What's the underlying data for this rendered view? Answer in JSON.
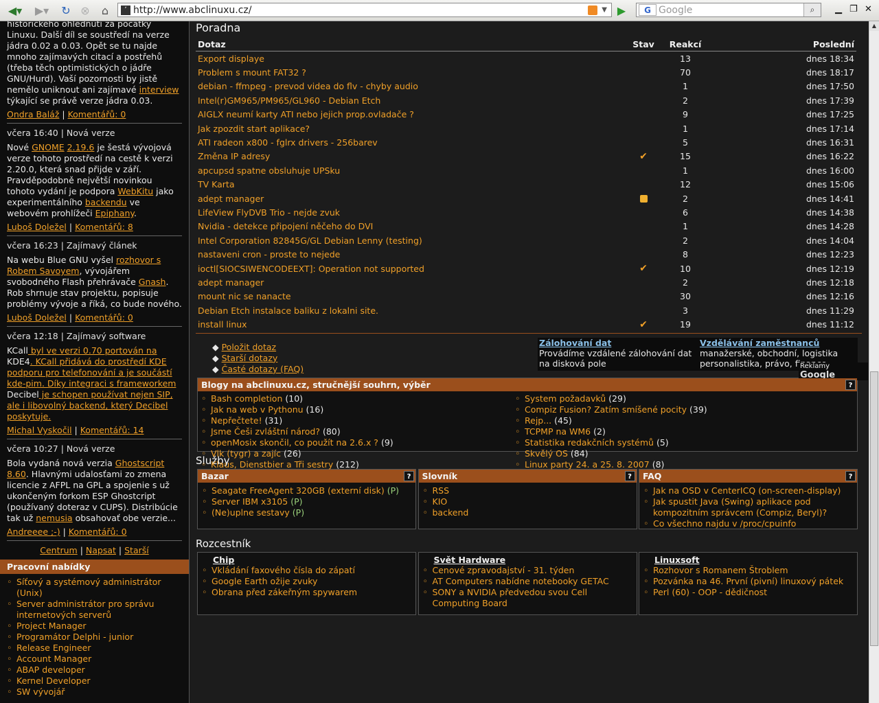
{
  "browser": {
    "url": "http://www.abclinuxu.cz/",
    "search_placeholder": "Google",
    "search_engine_badge": "G"
  },
  "left": {
    "intro_lines": [
      "historického ohlédnutí za počátky",
      "Linuxu. Další díl se soustředí na verze",
      "jádra 0.02 a 0.03. Opět se tu najde",
      "mnoho zajímavých citací a postřehů",
      "(třeba těch optimistických o jádře",
      "GNU/Hurd). Vaší pozornosti by jistě",
      "nemělo uniknout ani zajímavé"
    ],
    "intro_link": "interview",
    "intro_tail": "týkající se právě verze jádra 0.03.",
    "n0_author": "Ondra Baláž",
    "n0_comments": "Komentářů: 0",
    "n1_meta": "včera 16:40 | Nová verze",
    "n1": [
      "Nové ",
      "GNOME",
      " ",
      "2.19.6",
      " je šestá vývojová verze tohoto prostředí na cestě k verzi 2.20.0, která snad přijde v září. Pravděpodobně největší novinkou tohoto vydání je podpora ",
      "WebKitu",
      " jako experimentálního ",
      "backendu",
      " ve webovém prohlížeči ",
      "Epiphany",
      "."
    ],
    "n1_author": "Luboš Doležel",
    "n1_comments": "Komentářů: 8",
    "n2_meta": "včera 16:23 | Zajímavý článek",
    "n2": [
      "Na webu Blue GNU vyšel ",
      "rozhovor s Robem Savoyem",
      ", vývojářem svobodného Flash přehrávače ",
      "Gnash",
      ". Rob shrnuje stav projektu, popisuje problémy vývoje a říká, co bude nového."
    ],
    "n2_author": "Luboš Doležel",
    "n2_comments": "Komentářů: 0",
    "n3_meta": "včera 12:18 | Zajímavý software",
    "n3": [
      "KCall",
      " byl ve verzi 0.70 portován na ",
      "KDE4",
      ". KCall přidává do prostředí KDE podporu pro telefonování a je součástí kde-pim. Díky integraci s frameworkem ",
      "Decibel",
      " je schopen používat nejen SIP, ale i libovolný backend, který Decibel poskytuje."
    ],
    "n3_author": "Michal Vyskočil",
    "n3_comments": "Komentářů: 14",
    "n4_meta": "včera 10:27 | Nová verze",
    "n4": [
      "Bola vydaná nová verzia ",
      "Ghostscript 8.60",
      ". Hlavnými udalosťami zo zmena licencie z AFPL na GPL a spojenie s už ukončeným forkom ESP Ghostcript (používaný doteraz v CUPS). Distribúcie tak už ",
      "nemusia",
      " obsahovať obe verzie..."
    ],
    "n4_author": "Andreeee ;-)",
    "n4_comments": "Komentářů: 0",
    "nav": {
      "a": "Centrum",
      "b": "Napsat",
      "c": "Starší"
    },
    "jobs_title": "Pracovní nabídky",
    "jobs": [
      "Síťový a systémový administrátor (Unix)",
      "Server administrátor pro správu internetových serverů",
      "Project Manager",
      "Programátor Delphi - junior",
      "Release Engineer",
      "Account Manager",
      "ABAP developer",
      "Kernel Developer",
      "SW vývojář"
    ]
  },
  "poradna": {
    "title": "Poradna",
    "headers": {
      "q": "Dotaz",
      "s": "Stav",
      "r": "Reakcí",
      "l": "Poslední"
    },
    "rows": [
      {
        "q": "Export displaye",
        "s": "",
        "r": "13",
        "l": "dnes 18:34"
      },
      {
        "q": "Problem s mount FAT32 ?",
        "s": "",
        "r": "70",
        "l": "dnes 18:17"
      },
      {
        "q": "debian - ffmpeg - prevod videa do flv - chyby audio",
        "s": "",
        "r": "1",
        "l": "dnes 17:50"
      },
      {
        "q": "Intel(r)GM965/PM965/GL960 - Debian Etch",
        "s": "",
        "r": "2",
        "l": "dnes 17:39"
      },
      {
        "q": "AIGLX neumí karty ATI nebo jejich prop.ovladače ?",
        "s": "",
        "r": "9",
        "l": "dnes 17:25"
      },
      {
        "q": "Jak zpozdit start aplikace?",
        "s": "",
        "r": "1",
        "l": "dnes 17:14"
      },
      {
        "q": "ATI radeon x800 - fglrx drivers - 256barev",
        "s": "",
        "r": "5",
        "l": "dnes 16:31"
      },
      {
        "q": "Změna IP adresy",
        "s": "check",
        "r": "15",
        "l": "dnes 16:22"
      },
      {
        "q": "apcupsd spatne obsluhuje UPSku",
        "s": "",
        "r": "1",
        "l": "dnes 16:00"
      },
      {
        "q": "TV Karta",
        "s": "",
        "r": "12",
        "l": "dnes 15:06"
      },
      {
        "q": "adept manager",
        "s": "lock",
        "r": "2",
        "l": "dnes 14:41"
      },
      {
        "q": "LifeView FlyDVB Trio - nejde zvuk",
        "s": "",
        "r": "6",
        "l": "dnes 14:38"
      },
      {
        "q": "Nvidia - detekce připojení něčeho do DVI",
        "s": "",
        "r": "1",
        "l": "dnes 14:28"
      },
      {
        "q": "Intel Corporation 82845G/GL Debian Lenny (testing)",
        "s": "",
        "r": "2",
        "l": "dnes 14:04"
      },
      {
        "q": "nastaveni cron - proste to nejede",
        "s": "",
        "r": "8",
        "l": "dnes 12:23"
      },
      {
        "q": "ioctl[SIOCSIWENCODEEXT]: Operation not supported",
        "s": "check",
        "r": "10",
        "l": "dnes 12:19"
      },
      {
        "q": "adept manager",
        "s": "",
        "r": "2",
        "l": "dnes 12:18"
      },
      {
        "q": "mount nic se nanacte",
        "s": "",
        "r": "30",
        "l": "dnes 12:16"
      },
      {
        "q": "Debian Etch instalace baliku z lokalni site.",
        "s": "",
        "r": "3",
        "l": "dnes 11:29"
      },
      {
        "q": "install linux",
        "s": "check",
        "r": "19",
        "l": "dnes 11:12"
      }
    ],
    "links": [
      "Položit dotaz",
      "Starší dotazy",
      "Časté dotazy (FAQ)"
    ]
  },
  "ads": {
    "a_title": "Zálohování dat",
    "a_text": "Provádíme vzdálené zálohování dat na disková pole",
    "b_title": "Vzdělávání zaměstnanců",
    "b_text": "manažerské, obchodní, logistika personalistika, právo, finance",
    "brand_prefix": "Reklamy",
    "brand": "Google"
  },
  "blogy": {
    "title": "Blogy na abclinuxu.cz, stručnější souhrn, výběr",
    "help": "?",
    "left": [
      [
        "Bash completion",
        "(10)"
      ],
      [
        "Jak na web v Pythonu",
        "(16)"
      ],
      [
        "Nepřečtete!",
        "(31)"
      ],
      [
        "Jsme Češi zvláštní národ?",
        "(80)"
      ],
      [
        "openMosix skončil, co použít na 2.6.x ?",
        "(9)"
      ],
      [
        "Vlk (tygr) a zajíc",
        "(26)"
      ],
      [
        "Klaus, Dienstbier a Tři sestry",
        "(212)"
      ]
    ],
    "right": [
      [
        "System požadavků",
        "(29)"
      ],
      [
        "Compiz Fusion? Zatím smíšené pocity",
        "(39)"
      ],
      [
        "Rejp...",
        "(45)"
      ],
      [
        "TCPMP na WM6",
        "(2)"
      ],
      [
        "Statistika redakčních systémů",
        "(5)"
      ],
      [
        "Skvělý OS",
        "(84)"
      ],
      [
        "Linux party 24. a 25. 8. 2007",
        "(8)"
      ]
    ]
  },
  "sluzby": {
    "title": "Služby",
    "bazar": {
      "title": "Bazar",
      "items": [
        [
          "Seagate FreeAgent 320GB (externí disk)",
          "(P)"
        ],
        [
          "Server IBM x3105",
          "(P)"
        ],
        [
          "(Ne)uplne sestavy",
          "(P)"
        ]
      ]
    },
    "slovnik": {
      "title": "Slovník",
      "items": [
        "RSS",
        "KIO",
        "backend"
      ]
    },
    "faq": {
      "title": "FAQ",
      "items": [
        "Jak na OSD v CenterICQ (on-screen-display)",
        "Jak spustit Java (Swing) aplikace pod kompozitním správcem (Compiz, Beryl)?",
        "Co všechno najdu v /proc/cpuinfo"
      ]
    }
  },
  "rozcestnik": {
    "title": "Rozcestník",
    "chip": {
      "title": "Chip",
      "items": [
        "Vkládání faxového čísla do zápatí",
        "Google Earth ožije zvuky",
        "Obrana před zákeřným spywarem"
      ]
    },
    "svet": {
      "title": "Svět Hardware",
      "items": [
        "Cenové zpravodajství - 31. týden",
        "AT Computers nabídne notebooky GETAC",
        "SONY a NVIDIA předvedou svou Cell Computing Board"
      ]
    },
    "linuxsoft": {
      "title": "Linuxsoft",
      "items": [
        "Rozhovor s Romanem Štroblem",
        "Pozvánka na 46. První (pivní) linuxový pátek",
        "Perl (60) - OOP - dědičnost"
      ]
    }
  },
  "colors": {
    "accent": "#f0a028",
    "header_bar": "#9b4f1c",
    "background": "#1c1c1c"
  }
}
